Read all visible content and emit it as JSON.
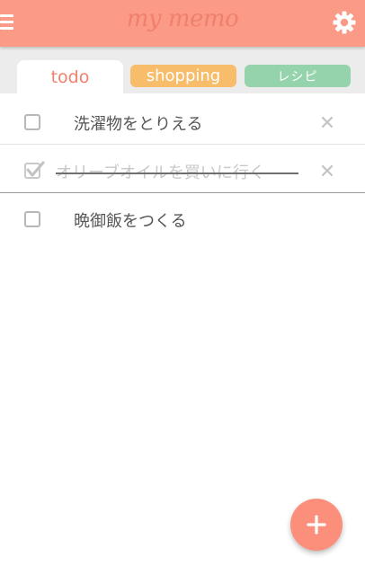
{
  "header": {
    "title": "my memo",
    "menu_icon": "menu-icon",
    "settings_icon": "gear-icon"
  },
  "tabs": [
    {
      "label": "todo",
      "selected": true,
      "color": "#ffffff",
      "text_color": "#f0806e"
    },
    {
      "label": "shopping",
      "selected": false,
      "color": "#f7bd6a",
      "text_color": "#ffffff"
    },
    {
      "label": "レシピ",
      "selected": false,
      "color": "#94d3ac",
      "text_color": "#ffffff"
    }
  ],
  "todo_items": [
    {
      "text": "洗濯物をとりえる",
      "checked": false,
      "deletable": true
    },
    {
      "text": "オリーブオイルを買いに行く",
      "checked": true,
      "deletable": true
    },
    {
      "text": "晩御飯をつくる",
      "checked": false,
      "deletable": false
    }
  ],
  "fab": {
    "icon": "plus-icon"
  },
  "colors": {
    "header": "#fb9a86",
    "accent": "#f0806e",
    "tabbar": "#ececec",
    "fab": "#fb8f7c"
  }
}
